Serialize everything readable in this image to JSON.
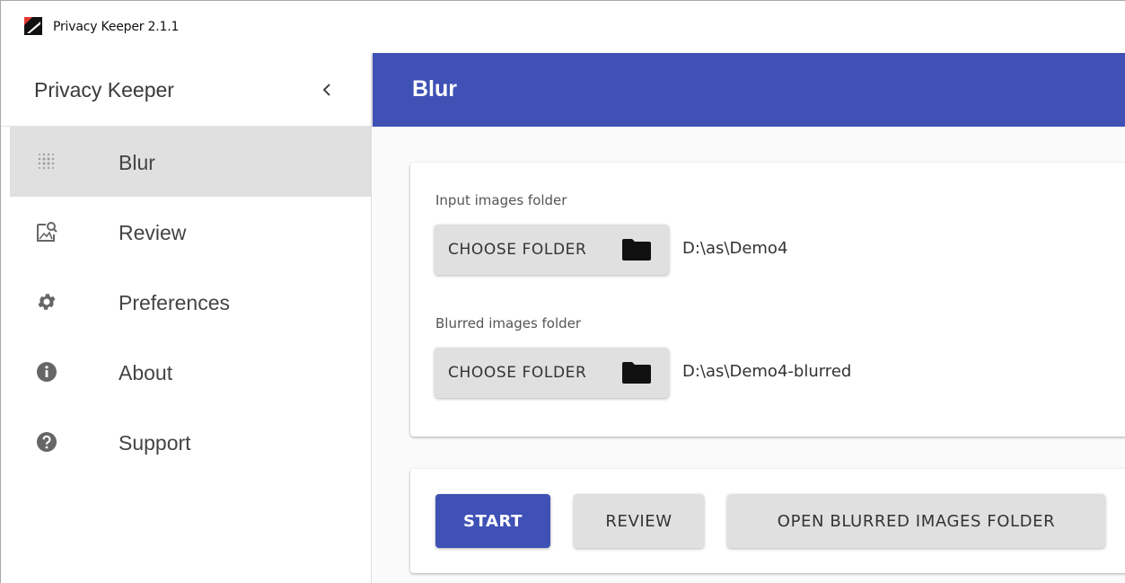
{
  "window": {
    "title": "Privacy Keeper 2.1.1",
    "icon": "app-logo-icon"
  },
  "sidebar": {
    "title": "Privacy Keeper",
    "collapse_icon": "chevron-left-icon",
    "items": [
      {
        "label": "Blur",
        "icon": "blur-dots-icon",
        "active": true
      },
      {
        "label": "Review",
        "icon": "image-search-icon",
        "active": false
      },
      {
        "label": "Preferences",
        "icon": "gear-icon",
        "active": false
      },
      {
        "label": "About",
        "icon": "info-icon",
        "active": false
      },
      {
        "label": "Support",
        "icon": "help-icon",
        "active": false
      }
    ]
  },
  "header": {
    "title": "Blur"
  },
  "folders": {
    "input": {
      "label": "Input images folder",
      "button_label": "CHOOSE FOLDER",
      "path": "D:\\as\\Demo4"
    },
    "output": {
      "label": "Blurred images folder",
      "button_label": "CHOOSE FOLDER",
      "path": "D:\\as\\Demo4-blurred"
    }
  },
  "actions": {
    "start_label": "START",
    "review_label": "REVIEW",
    "open_folder_label": "OPEN BLURRED IMAGES FOLDER"
  },
  "colors": {
    "primary": "#3f51b5",
    "active_nav_bg": "#e0e0e0",
    "button_bg": "#e0e0e0"
  }
}
